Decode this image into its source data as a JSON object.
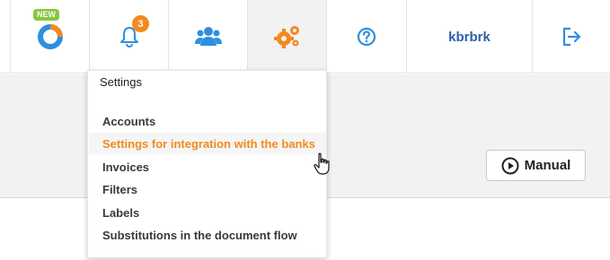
{
  "nav": {
    "new_badge": "NEW",
    "notification_count": "3",
    "username": "kbrbrk"
  },
  "dropdown": {
    "title": "Settings",
    "items": [
      "Accounts",
      "Settings for integration with the banks",
      "Invoices",
      "Filters",
      "Labels",
      "Substitutions in the document flow"
    ],
    "hovered_item": "Settings for integration with the banks"
  },
  "manual_button": {
    "label": "Manual"
  },
  "colors": {
    "brand_blue": "#2e8fe0",
    "accent_orange": "#f28a1e",
    "badge_green": "#8ac43f",
    "username_blue": "#2c5fa8"
  },
  "icons": [
    "app-logo-icon",
    "bell-icon",
    "users-icon",
    "gears-icon",
    "help-icon",
    "logout-icon",
    "play-circle-icon",
    "hand-cursor-icon"
  ]
}
